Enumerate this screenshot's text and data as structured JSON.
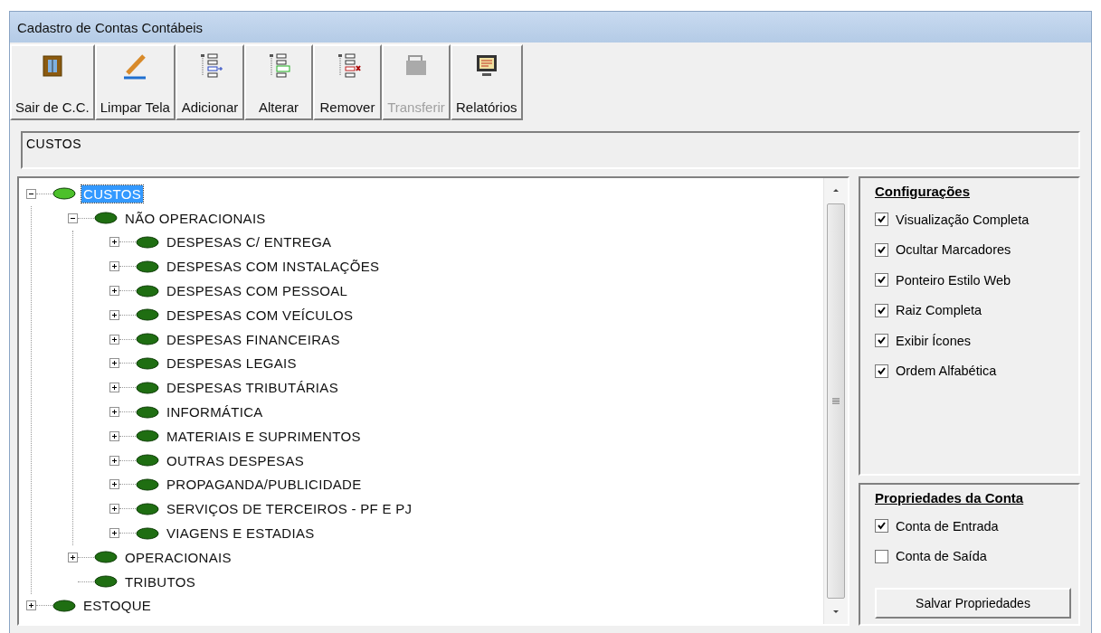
{
  "window": {
    "title": "Cadastro de Contas Contábeis"
  },
  "toolbar": [
    {
      "label": "Sair de C.C.",
      "disabled": false
    },
    {
      "label": "Limpar Tela",
      "disabled": false
    },
    {
      "label": "Adicionar",
      "disabled": false
    },
    {
      "label": "Alterar",
      "disabled": false
    },
    {
      "label": "Remover",
      "disabled": false
    },
    {
      "label": "Transferir",
      "disabled": true
    },
    {
      "label": "Relatórios",
      "disabled": false
    }
  ],
  "path_field": {
    "value": "CUSTOS"
  },
  "tree": [
    {
      "label": "CUSTOS",
      "selected": true,
      "expanded": true,
      "children": [
        {
          "label": "NÃO OPERACIONAIS",
          "selected": false,
          "expanded": true,
          "children": [
            {
              "label": "DESPESAS C/ ENTREGA",
              "selected": false,
              "expanded": false
            },
            {
              "label": "DESPESAS COM INSTALAÇÕES",
              "selected": false,
              "expanded": false
            },
            {
              "label": "DESPESAS COM PESSOAL",
              "selected": false,
              "expanded": false
            },
            {
              "label": "DESPESAS COM VEÍCULOS",
              "selected": false,
              "expanded": false
            },
            {
              "label": "DESPESAS FINANCEIRAS",
              "selected": false,
              "expanded": false
            },
            {
              "label": "DESPESAS LEGAIS",
              "selected": false,
              "expanded": false
            },
            {
              "label": "DESPESAS TRIBUTÁRIAS",
              "selected": false,
              "expanded": false
            },
            {
              "label": "INFORMÁTICA",
              "selected": false,
              "expanded": false
            },
            {
              "label": "MATERIAIS E SUPRIMENTOS",
              "selected": false,
              "expanded": false
            },
            {
              "label": "OUTRAS DESPESAS",
              "selected": false,
              "expanded": false
            },
            {
              "label": "PROPAGANDA/PUBLICIDADE",
              "selected": false,
              "expanded": false
            },
            {
              "label": "SERVIÇOS DE TERCEIROS - PF E PJ",
              "selected": false,
              "expanded": false
            },
            {
              "label": "VIAGENS E ESTADIAS",
              "selected": false,
              "expanded": false
            }
          ]
        },
        {
          "label": "OPERACIONAIS",
          "selected": false,
          "expanded": false
        },
        {
          "label": "TRIBUTOS",
          "selected": false
        }
      ]
    },
    {
      "label": "ESTOQUE",
      "selected": false,
      "expanded": false
    }
  ],
  "configuracoes": {
    "title": "Configurações",
    "options": [
      {
        "label": "Visualização Completa",
        "checked": true
      },
      {
        "label": "Ocultar Marcadores",
        "checked": true
      },
      {
        "label": "Ponteiro Estilo Web",
        "checked": true
      },
      {
        "label": "Raiz Completa",
        "checked": true
      },
      {
        "label": "Exibir Ícones",
        "checked": true
      },
      {
        "label": "Ordem Alfabética",
        "checked": true
      }
    ]
  },
  "propriedades": {
    "title": "Propriedades da Conta",
    "options": [
      {
        "label": "Conta de Entrada",
        "checked": true
      },
      {
        "label": "Conta de Saída",
        "checked": false
      }
    ],
    "button": "Salvar Propriedades"
  }
}
